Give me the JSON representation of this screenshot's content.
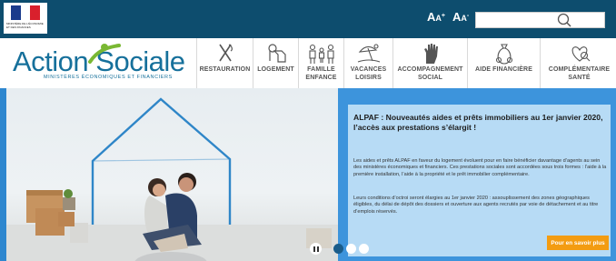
{
  "topbar": {
    "gov_logo_text": "MINISTÈRE DE L'ÉCONOMIE ET DES FINANCES",
    "font_increase_label": "AA+",
    "font_decrease_label": "AA-",
    "search": {
      "value": "",
      "placeholder": ""
    },
    "colors": {
      "background": "#0d4d6e",
      "flag_blue": "#1a3b8c",
      "flag_white": "#ffffff",
      "flag_red": "#d9202c"
    }
  },
  "brand": {
    "name_part1": "Action",
    "name_part2": "Sociale",
    "subtitle": "MINISTÈRES ÉCONOMIQUES ET FINANCIERS",
    "colors": {
      "blue": "#16709b",
      "green": "#7ab833"
    }
  },
  "nav": {
    "items": [
      {
        "label": "RESTAURATION",
        "icon": "fork-knife-icon"
      },
      {
        "label": "LOGEMENT",
        "icon": "house-key-icon"
      },
      {
        "label": "FAMILLE ENFANCE",
        "icon": "family-icon"
      },
      {
        "label": "VACANCES LOISIRS",
        "icon": "umbrella-beach-icon"
      },
      {
        "label": "ACCOMPAGNEMENT SOCIAL",
        "icon": "hand-icon"
      },
      {
        "label": "AIDE FINANCIÈRE",
        "icon": "money-bag-icon"
      },
      {
        "label": "COMPLÉMENTAIRE SANTÉ",
        "icon": "heart-magnifier-icon"
      }
    ]
  },
  "hero": {
    "title": "ALPAF : Nouveautés aides et prêts immobiliers au 1er janvier 2020, l’accès aux prestations s’élargit !",
    "paragraph1": "Les aides et prêts ALPAF en faveur du logement évoluent pour en faire bénéficier davantage d’agents au sein des ministères économiques et financiers. Ces prestations sociales sont accordées sous trois formes : l’aide à la première installation, l’aide à la propriété et le prêt immobilier complémentaire.",
    "paragraph2": "Leurs conditions d’octroi seront élargies au 1er janvier 2020 : assouplissement des zones géographiques éligibles, du délai de dépôt des dossiers et ouverture aux agents recrutés par voie de détachement et au titre d’emplois réservés.",
    "more_button": "Pour en savoir plus",
    "slides_total": 3,
    "active_slide": 1,
    "colors": {
      "panel": "#b7dbf5",
      "background": "#3d94dc",
      "button": "#f39c12",
      "dot_active": "#1a5c8a",
      "dot_inactive": "#ffffff"
    }
  }
}
